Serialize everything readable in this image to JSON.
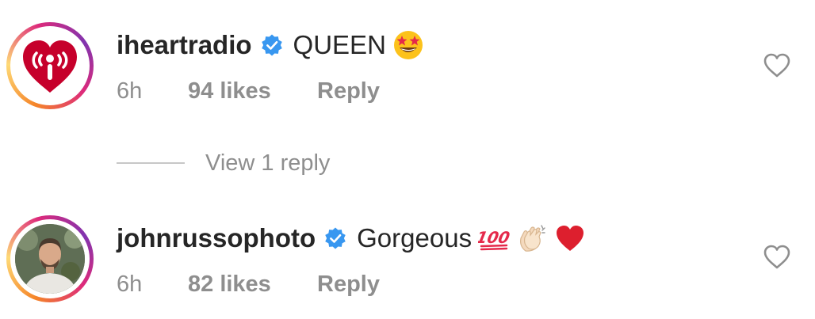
{
  "comments": [
    {
      "username": "iheartradio",
      "text": "QUEEN",
      "emojis": [
        "star-struck-emoji"
      ],
      "time": "6h",
      "likes": "94 likes",
      "reply": "Reply",
      "verified": true
    },
    {
      "username": "johnrussophoto",
      "text": "Gorgeous",
      "emojis": [
        "hundred-points-emoji",
        "clapping-hands-emoji",
        "red-heart-emoji"
      ],
      "time": "6h",
      "likes": "82 likes",
      "reply": "Reply",
      "verified": true
    }
  ],
  "view_replies": {
    "label": "View 1 reply"
  },
  "colors": {
    "primary_text": "#262626",
    "secondary_text": "#8e8e8e",
    "verified_blue": "#3897f0",
    "iheart_red": "#c6002b"
  }
}
